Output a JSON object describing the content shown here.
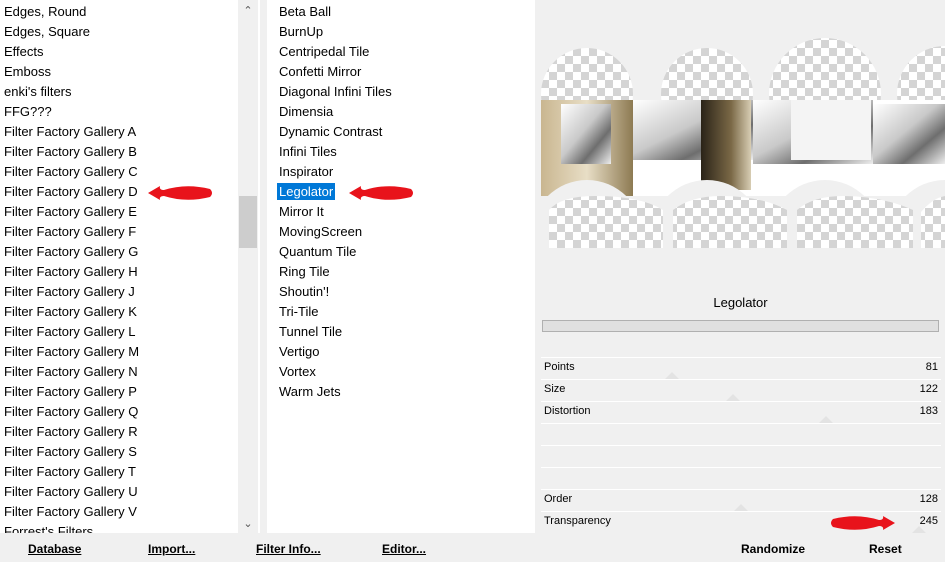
{
  "categories": {
    "items": [
      "Edges, Round",
      "Edges, Square",
      "Effects",
      "Emboss",
      "enki's filters",
      "FFG???",
      "Filter Factory Gallery A",
      "Filter Factory Gallery B",
      "Filter Factory Gallery C",
      "Filter Factory Gallery D",
      "Filter Factory Gallery E",
      "Filter Factory Gallery F",
      "Filter Factory Gallery G",
      "Filter Factory Gallery H",
      "Filter Factory Gallery J",
      "Filter Factory Gallery K",
      "Filter Factory Gallery L",
      "Filter Factory Gallery M",
      "Filter Factory Gallery N",
      "Filter Factory Gallery P",
      "Filter Factory Gallery Q",
      "Filter Factory Gallery R",
      "Filter Factory Gallery S",
      "Filter Factory Gallery T",
      "Filter Factory Gallery U",
      "Filter Factory Gallery V",
      "Forrest's Filters"
    ],
    "marked": "Filter Factory Gallery D"
  },
  "filters": {
    "items": [
      "Beta Ball",
      "BurnUp",
      "Centripedal Tile",
      "Confetti Mirror",
      "Diagonal Infini Tiles",
      "Dimensia",
      "Dynamic Contrast",
      "Infini Tiles",
      "Inspirator",
      "Legolator",
      "Mirror It",
      "MovingScreen",
      "Quantum Tile",
      "Ring Tile",
      "Shoutin'!",
      "Tri-Tile",
      "Tunnel Tile",
      "Vertigo",
      "Vortex",
      "Warm Jets"
    ],
    "selected": "Legolator"
  },
  "filter_title": "Legolator",
  "params": [
    {
      "label": "Points",
      "value": "81",
      "level": 0.32
    },
    {
      "label": "Size",
      "value": "122",
      "level": 0.48
    },
    {
      "label": "Distortion",
      "value": "183",
      "level": 0.72
    },
    {
      "label": "",
      "value": ""
    },
    {
      "label": "",
      "value": ""
    },
    {
      "label": "",
      "value": ""
    },
    {
      "label": "Order",
      "value": "128",
      "level": 0.5
    },
    {
      "label": "Transparency",
      "value": "245",
      "level": 0.96
    }
  ],
  "toolbar": {
    "database": "Database",
    "import": "Import...",
    "filter_info": "Filter Info...",
    "editor": "Editor...",
    "randomize": "Randomize",
    "reset": "Reset"
  },
  "colors": {
    "selection": "#0078d7",
    "arrow": "#e8131b"
  }
}
